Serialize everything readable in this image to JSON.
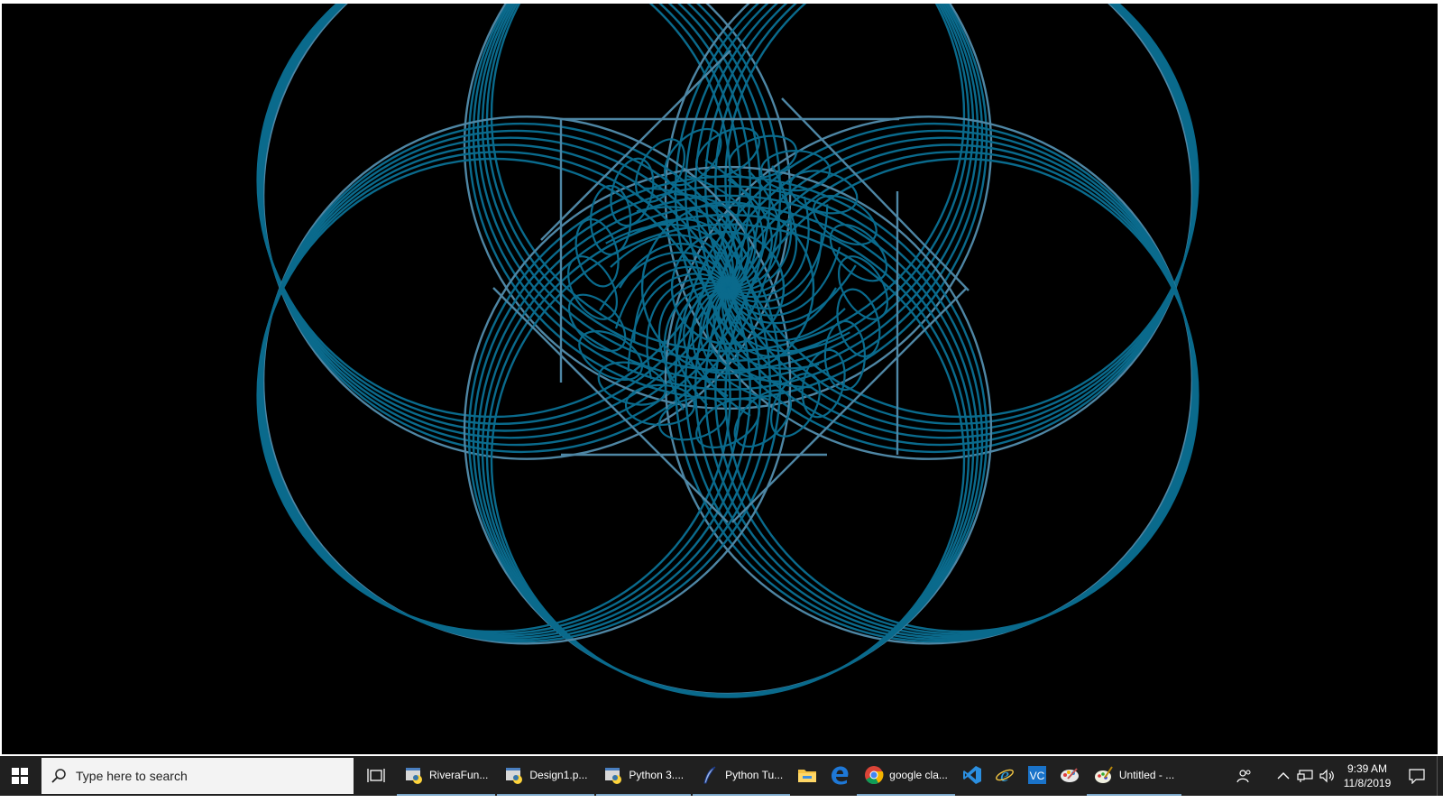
{
  "canvas": {
    "background": "#000000",
    "stroke": "#0a6a8c",
    "stroke_light": "#4e86a4"
  },
  "taskbar": {
    "search": {
      "placeholder": "Type here to search"
    },
    "apps": [
      {
        "label": "RiveraFun...",
        "icon": "python-idle-icon"
      },
      {
        "label": "Design1.p...",
        "icon": "python-idle-icon"
      },
      {
        "label": "Python 3....",
        "icon": "python-idle-icon"
      },
      {
        "label": "Python Tu...",
        "icon": "feather-pen-icon"
      }
    ],
    "pinned": [
      {
        "icon": "file-explorer-icon"
      },
      {
        "icon": "edge-icon"
      }
    ],
    "apps2": [
      {
        "label": "google cla...",
        "icon": "chrome-icon"
      }
    ],
    "pinned2": [
      {
        "icon": "visual-studio-icon"
      },
      {
        "icon": "internet-explorer-icon"
      },
      {
        "icon": "vc-app-icon"
      },
      {
        "icon": "paint-3d-icon"
      }
    ],
    "apps3": [
      {
        "label": "Untitled - ...",
        "icon": "paint-icon"
      }
    ],
    "clock": {
      "time": "9:39 AM",
      "date": "11/8/2019"
    }
  }
}
